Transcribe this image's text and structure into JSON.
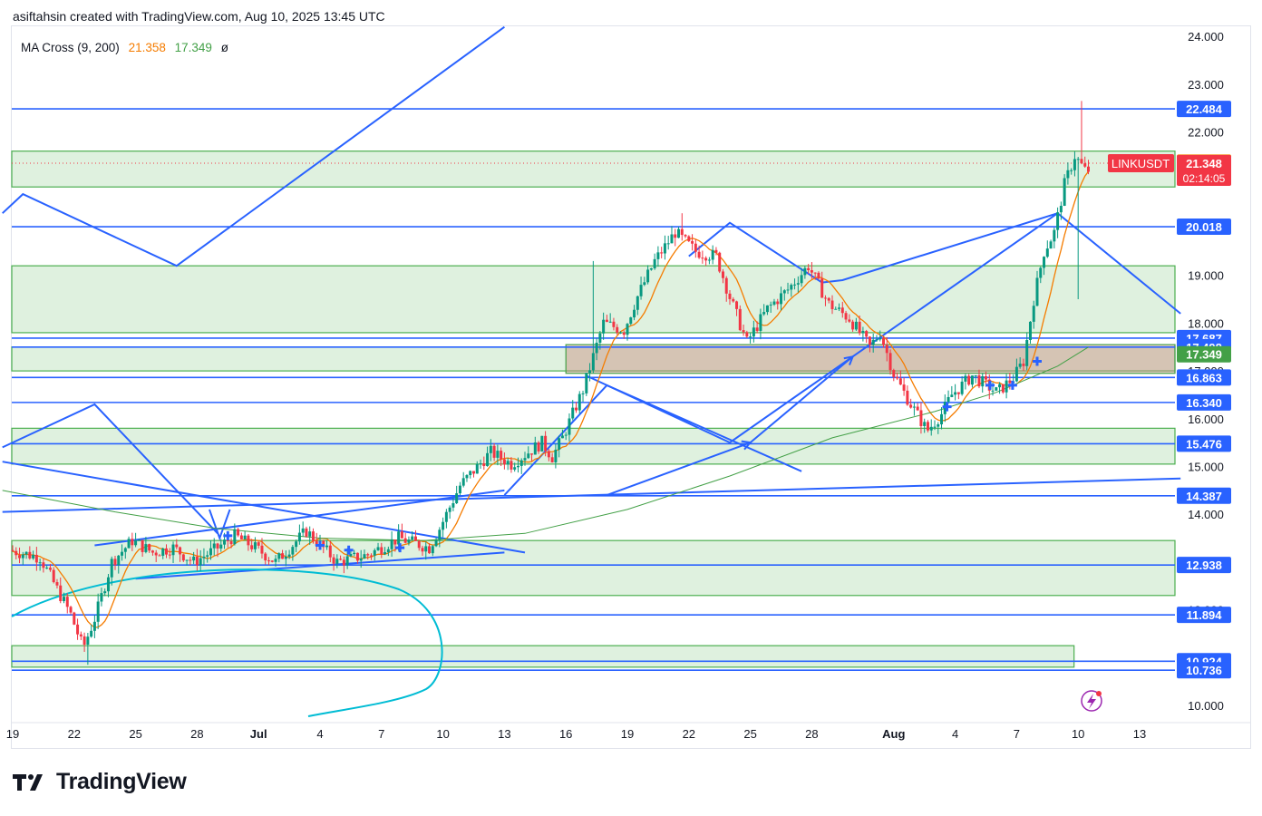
{
  "header": {
    "text": "asiftahsin created with TradingView.com, Aug 10, 2025 13:45 UTC"
  },
  "legend": {
    "name": "MA Cross (9, 200)",
    "ma_fast": "21.358",
    "ma_slow": "17.349",
    "icon": "ø"
  },
  "symbol": "LINKUSDT",
  "price_tag": {
    "value": "21.348",
    "countdown": "02:14:05"
  },
  "brand": {
    "logo_text": "TradingView"
  },
  "colors": {
    "bull": "#089981",
    "bear": "#f23645",
    "blue": "#2962ff",
    "zone_green": "#4caf50",
    "zone_red": "#c8857a",
    "ma_fast": "#f57c00",
    "ma_slow": "#43a047",
    "cyan": "#00bcd4"
  },
  "chart_data": {
    "type": "candlestick",
    "symbol": "LINKUSDT",
    "y_axis": {
      "min": 10,
      "max": 24,
      "ticks": [
        "10.000",
        "11.000",
        "12.000",
        "13.000",
        "14.000",
        "15.000",
        "16.000",
        "17.000",
        "18.000",
        "19.000",
        "20.000",
        "21.000",
        "22.000",
        "23.000",
        "24.000"
      ]
    },
    "x_axis": {
      "first_day": "Jun 19",
      "last_day": "Aug 14",
      "ticks": [
        {
          "label": "19",
          "day": 0
        },
        {
          "label": "22",
          "day": 3
        },
        {
          "label": "25",
          "day": 6
        },
        {
          "label": "28",
          "day": 9
        },
        {
          "label": "Jul",
          "day": 12
        },
        {
          "label": "4",
          "day": 15
        },
        {
          "label": "7",
          "day": 18
        },
        {
          "label": "10",
          "day": 21
        },
        {
          "label": "13",
          "day": 24
        },
        {
          "label": "16",
          "day": 27
        },
        {
          "label": "19",
          "day": 30
        },
        {
          "label": "22",
          "day": 33
        },
        {
          "label": "25",
          "day": 36
        },
        {
          "label": "28",
          "day": 39
        },
        {
          "label": "Aug",
          "day": 43
        },
        {
          "label": "4",
          "day": 46
        },
        {
          "label": "7",
          "day": 49
        },
        {
          "label": "10",
          "day": 52
        },
        {
          "label": "13",
          "day": 55
        }
      ]
    },
    "price_path": [
      [
        0,
        13.25
      ],
      [
        1.5,
        13.1
      ],
      [
        3,
        11.9
      ],
      [
        3.6,
        11.2
      ],
      [
        4.2,
        11.85
      ],
      [
        5,
        13.0
      ],
      [
        6,
        13.45
      ],
      [
        7,
        13.2
      ],
      [
        8,
        13.3
      ],
      [
        9,
        13.0
      ],
      [
        10,
        13.25
      ],
      [
        11,
        13.55
      ],
      [
        12,
        13.3
      ],
      [
        13,
        13.0
      ],
      [
        14.5,
        13.65
      ],
      [
        16,
        13.0
      ],
      [
        17.5,
        13.15
      ],
      [
        19,
        13.5
      ],
      [
        20.5,
        13.3
      ],
      [
        21,
        13.7
      ],
      [
        22,
        14.6
      ],
      [
        23.5,
        15.3
      ],
      [
        24.5,
        15.05
      ],
      [
        26,
        15.5
      ],
      [
        26.5,
        15.2
      ],
      [
        27,
        15.6
      ],
      [
        28,
        16.6
      ],
      [
        29,
        18.0
      ],
      [
        30,
        17.85
      ],
      [
        30.6,
        18.5
      ],
      [
        31.5,
        19.3
      ],
      [
        32.5,
        19.9
      ],
      [
        33.5,
        19.5
      ],
      [
        34.5,
        19.4
      ],
      [
        35.2,
        18.5
      ],
      [
        36,
        17.6
      ],
      [
        37,
        18.3
      ],
      [
        38,
        18.7
      ],
      [
        39,
        19.2
      ],
      [
        40,
        18.4
      ],
      [
        41,
        18.1
      ],
      [
        42,
        17.5
      ],
      [
        42.5,
        17.8
      ],
      [
        43.2,
        16.9
      ],
      [
        44,
        16.3
      ],
      [
        44.8,
        15.75
      ],
      [
        45.5,
        16.1
      ],
      [
        46,
        16.5
      ],
      [
        47,
        16.9
      ],
      [
        48.2,
        16.55
      ],
      [
        49,
        16.85
      ],
      [
        49.5,
        17.2
      ],
      [
        50,
        18.5
      ],
      [
        50.5,
        19.5
      ],
      [
        51,
        19.9
      ],
      [
        51.5,
        20.9
      ],
      [
        52,
        21.5
      ],
      [
        52.5,
        21.2
      ]
    ],
    "ma_fast": {
      "name": "MA 9",
      "last_value": 21.358
    },
    "ma_slow": {
      "name": "MA 200",
      "last_value": 17.349
    },
    "horizontal_levels": [
      22.484,
      20.018,
      17.687,
      17.498,
      16.863,
      16.34,
      15.476,
      14.387,
      12.938,
      11.894,
      10.924,
      10.736
    ],
    "price_labels": [
      {
        "text": "22.484",
        "value": 22.484,
        "kind": "level"
      },
      {
        "text": "21.358",
        "value": 21.358,
        "kind": "ma_fast"
      },
      {
        "text": "21.348",
        "value": 21.348,
        "kind": "price"
      },
      {
        "text": "20.018",
        "value": 20.018,
        "kind": "level"
      },
      {
        "text": "17.687",
        "value": 17.687,
        "kind": "level"
      },
      {
        "text": "17.498",
        "value": 17.498,
        "kind": "level"
      },
      {
        "text": "17.349",
        "value": 17.349,
        "kind": "ma_slow"
      },
      {
        "text": "16.863",
        "value": 16.863,
        "kind": "level"
      },
      {
        "text": "16.340",
        "value": 16.34,
        "kind": "level"
      },
      {
        "text": "15.476",
        "value": 15.476,
        "kind": "level"
      },
      {
        "text": "14.387",
        "value": 14.387,
        "kind": "level"
      },
      {
        "text": "12.938",
        "value": 12.938,
        "kind": "level"
      },
      {
        "text": "11.894",
        "value": 11.894,
        "kind": "level"
      },
      {
        "text": "10.924",
        "value": 10.924,
        "kind": "level"
      },
      {
        "text": "10.736",
        "value": 10.736,
        "kind": "level"
      }
    ],
    "zones": [
      {
        "color": "green",
        "from_day": -0.5,
        "to_day": 57,
        "low": 20.85,
        "high": 21.6
      },
      {
        "color": "green",
        "from_day": -0.5,
        "to_day": 57,
        "low": 17.8,
        "high": 19.2
      },
      {
        "color": "green",
        "from_day": -0.5,
        "to_day": 57,
        "low": 17.0,
        "high": 17.5
      },
      {
        "color": "red",
        "from_day": 27,
        "to_day": 57,
        "low": 16.95,
        "high": 17.55
      },
      {
        "color": "green",
        "from_day": -0.5,
        "to_day": 57,
        "low": 15.05,
        "high": 15.8
      },
      {
        "color": "green",
        "from_day": -0.5,
        "to_day": 57,
        "low": 12.3,
        "high": 13.45
      },
      {
        "color": "green",
        "from_day": -0.5,
        "to_day": 51.8,
        "low": 10.8,
        "high": 11.25
      }
    ],
    "trendlines": [
      {
        "points": [
          [
            -0.5,
            20.3
          ],
          [
            0.5,
            20.7
          ],
          [
            8,
            19.2
          ],
          [
            24,
            24.2
          ]
        ]
      },
      {
        "points": [
          [
            -0.5,
            15.4
          ],
          [
            4,
            16.3
          ],
          [
            10,
            13.6
          ]
        ]
      },
      {
        "points": [
          [
            -0.5,
            15.1
          ],
          [
            25,
            13.2
          ]
        ]
      },
      {
        "points": [
          [
            -0.5,
            14.05
          ],
          [
            57,
            14.75
          ]
        ]
      },
      {
        "points": [
          [
            4,
            13.35
          ],
          [
            24,
            14.5
          ]
        ]
      },
      {
        "points": [
          [
            6,
            12.65
          ],
          [
            24,
            13.2
          ]
        ]
      },
      {
        "points": [
          [
            28,
            16.9
          ],
          [
            35,
            15.5
          ],
          [
            51,
            20.3
          ],
          [
            57,
            18.2
          ]
        ]
      },
      {
        "points": [
          [
            33,
            19.4
          ],
          [
            35,
            20.1
          ],
          [
            39.5,
            18.85
          ],
          [
            40.5,
            18.9
          ],
          [
            51,
            20.3
          ]
        ]
      },
      {
        "points": [
          [
            24,
            14.4
          ],
          [
            29,
            16.7
          ],
          [
            38.5,
            14.9
          ]
        ]
      }
    ],
    "arrows": [
      {
        "points": [
          [
            29,
            14.4
          ],
          [
            36,
            15.5
          ]
        ]
      },
      {
        "points": [
          [
            36,
            15.5
          ],
          [
            41,
            17.3
          ]
        ]
      }
    ],
    "annotation_markers": [
      [
        10.5,
        13.55
      ],
      [
        15,
        13.35
      ],
      [
        16.4,
        13.25
      ],
      [
        18.9,
        13.3
      ],
      [
        45.6,
        16.25
      ],
      [
        47.7,
        16.7
      ],
      [
        48.8,
        16.7
      ],
      [
        50,
        17.2
      ]
    ]
  }
}
